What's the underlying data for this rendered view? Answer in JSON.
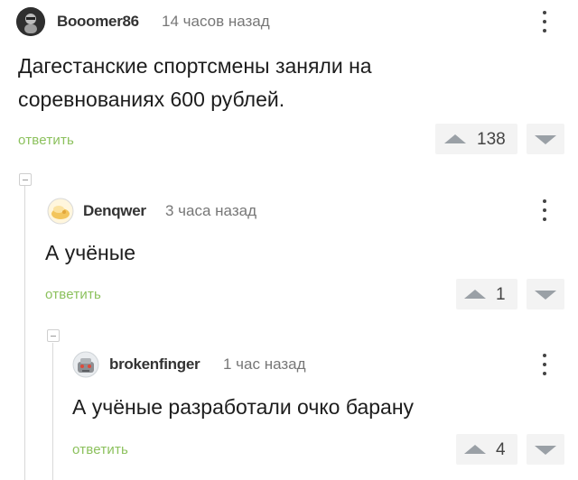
{
  "comments": [
    {
      "avatar_icon": "user-avatar-icon",
      "username": "Booomer86",
      "time": "14 часов назад",
      "text_lines": [
        "Дагестанские спортсмены заняли на",
        "соревнованиях 600 рублей."
      ],
      "reply_label": "ответить",
      "score": "138"
    },
    {
      "avatar_icon": "user-avatar-icon",
      "username": "Denqwer",
      "time": "3 часа назад",
      "text_lines": [
        "А учёные"
      ],
      "reply_label": "ответить",
      "score": "1"
    },
    {
      "avatar_icon": "user-avatar-icon",
      "username": "brokenfinger",
      "time": "1 час назад",
      "text_lines": [
        "А учёные разработали очко барану"
      ],
      "reply_label": "ответить",
      "score": "4"
    }
  ],
  "colors": {
    "reply_link": "#8cc15d",
    "vote_box": "#f3f3f3",
    "vote_arrow": "#9aa0a6",
    "thread_line": "#d9d9d9"
  },
  "icons": {
    "more": "more-vertical-icon",
    "upvote": "upvote-arrow-icon",
    "downvote": "downvote-arrow-icon",
    "collapse": "collapse-thread-icon"
  }
}
